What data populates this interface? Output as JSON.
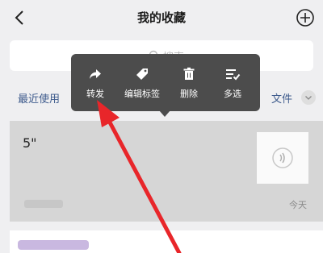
{
  "header": {
    "title": "我的收藏",
    "back_icon": "chevron-left-icon",
    "add_icon": "plus-circle-icon"
  },
  "search": {
    "placeholder": "搜索"
  },
  "filters": {
    "left_label": "最近使用",
    "right_label": "文件"
  },
  "context_menu": {
    "items": [
      {
        "label": "转发",
        "icon": "share-arrow-icon"
      },
      {
        "label": "编辑标签",
        "icon": "tag-icon"
      },
      {
        "label": "删除",
        "icon": "trash-icon"
      },
      {
        "label": "多选",
        "icon": "multi-select-icon"
      }
    ],
    "background": "#4c4c4c"
  },
  "favorite_item": {
    "text": "5\"",
    "date": "今天",
    "thumb_icon": "audio-waves-icon"
  },
  "colors": {
    "link": "#3d5a8c",
    "annotation_arrow": "#e8262a"
  }
}
